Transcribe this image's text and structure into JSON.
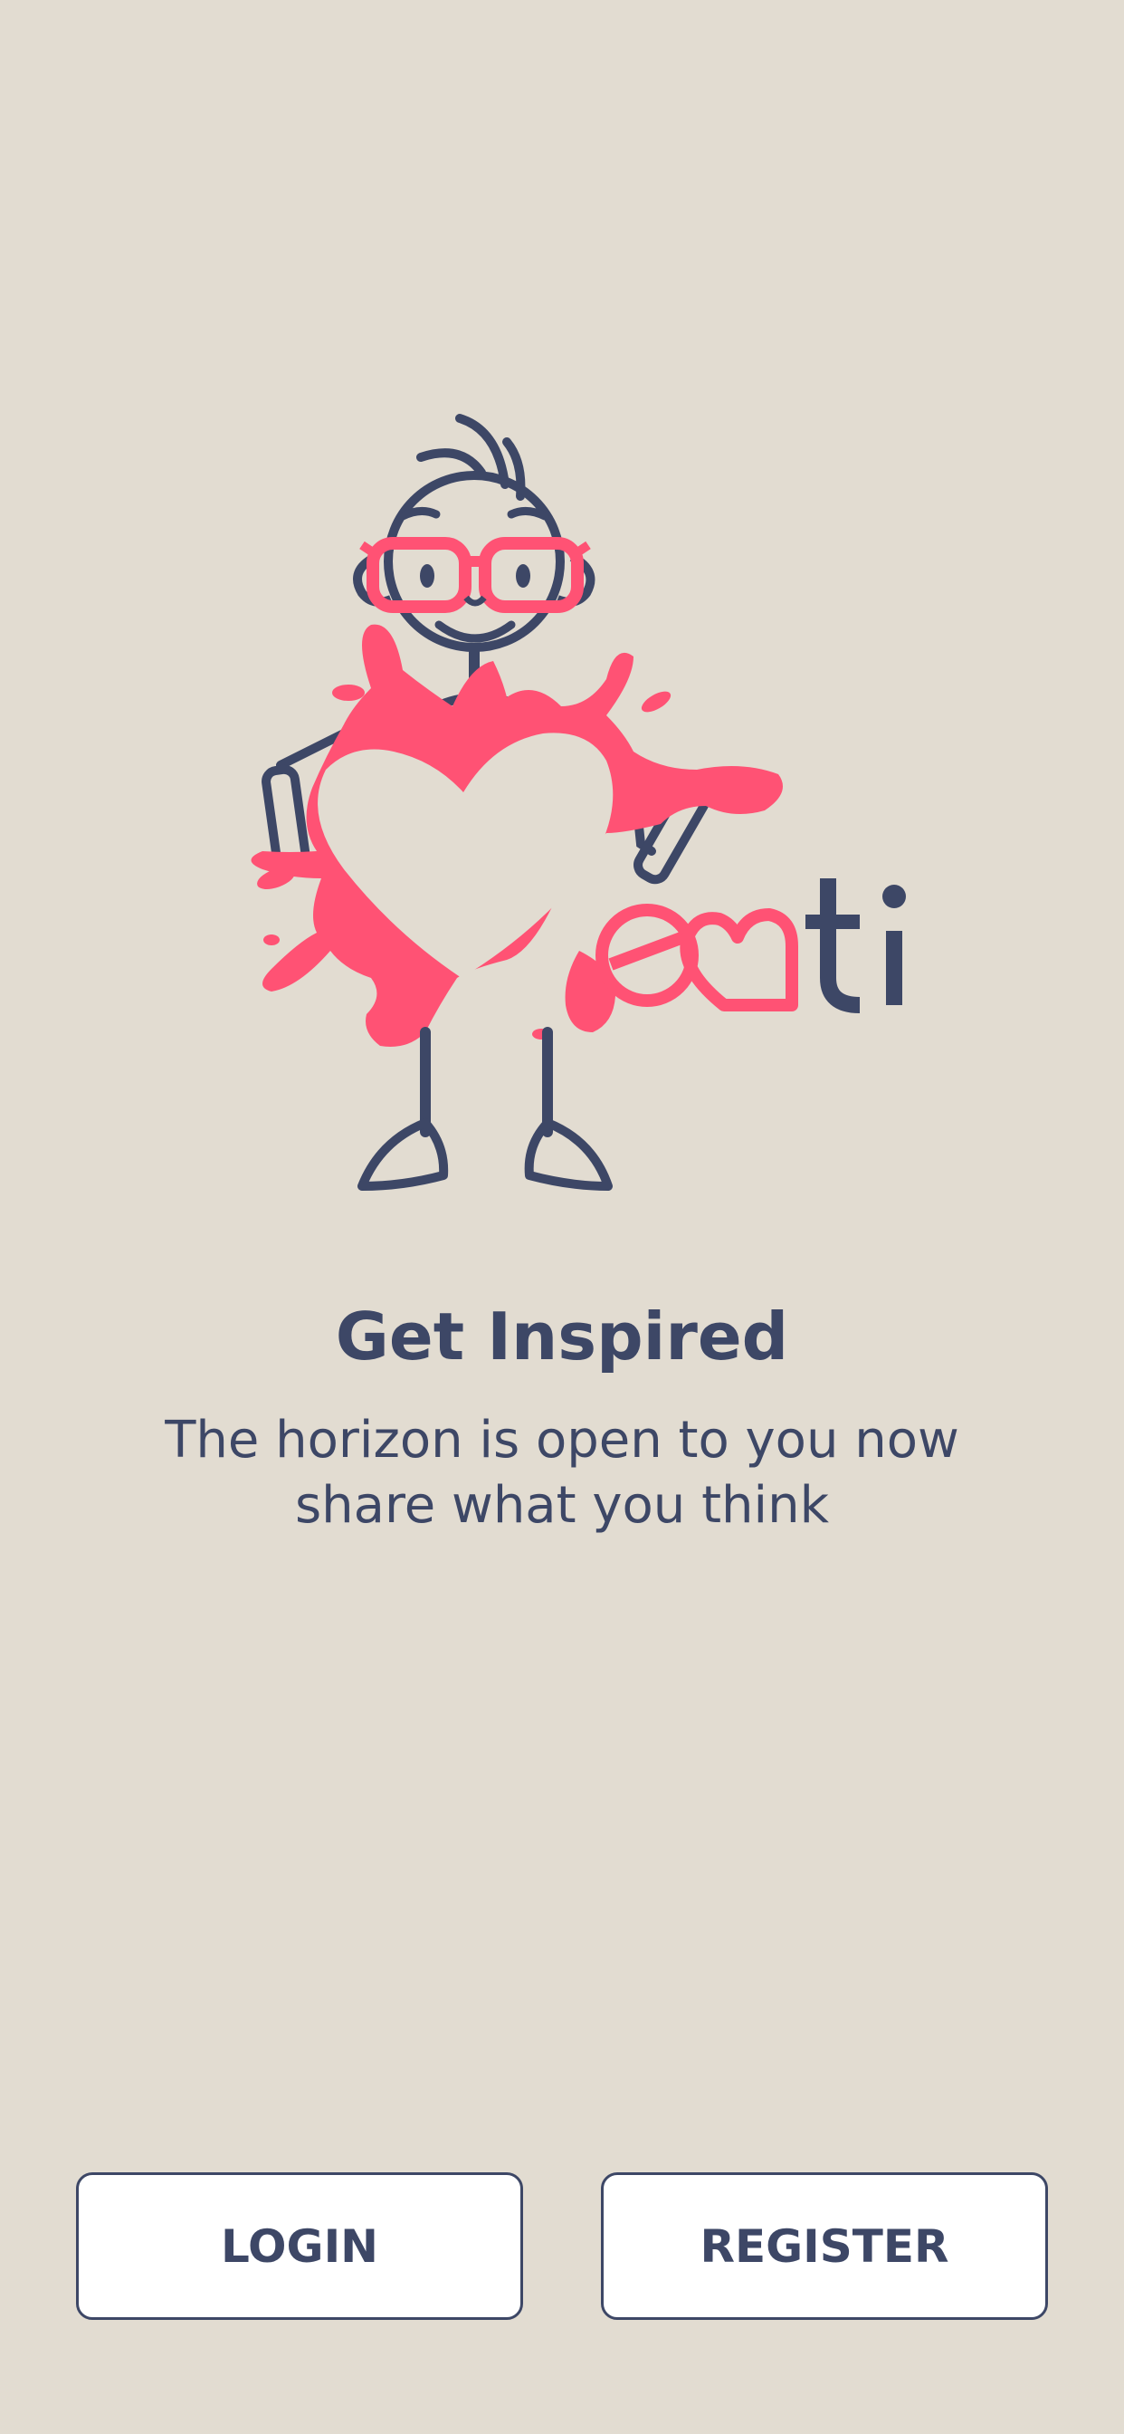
{
  "brand": {
    "logo_icon": "heati-stickman-heart-logo",
    "wordmark": "eati",
    "primary_color": "#3d4766",
    "accent_color": "#ff5274",
    "background_color": "#e2dcd1"
  },
  "onboarding": {
    "title": "Get Inspired",
    "subtitle_line1": "The horizon is open to you now",
    "subtitle_line2": "share what you think"
  },
  "actions": {
    "login_label": "LOGIN",
    "register_label": "REGISTER"
  }
}
